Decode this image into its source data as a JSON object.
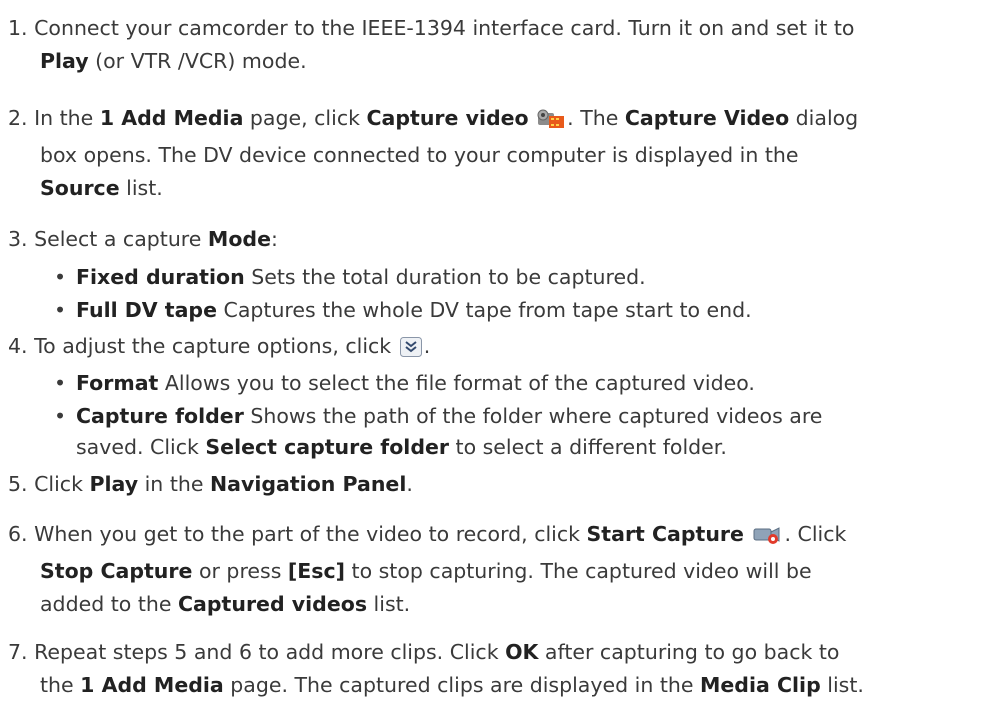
{
  "steps": [
    {
      "num": "1.",
      "p1": "Connect your camcorder to the IEEE-1394 interface card. Turn it on and set it to",
      "b1": "Play",
      "p2": " (or VTR /VCR) mode."
    },
    {
      "num": "2.",
      "p1": "In the ",
      "b1": "1 Add Media",
      "p2": " page, click ",
      "b2": "Capture video",
      "p3": ". The ",
      "b3": "Capture Video",
      "p4": " dialog",
      "p5": "box opens. The DV device connected to your computer is displayed in the",
      "b4": "Source",
      "p6": " list."
    },
    {
      "num": "3.",
      "p1": "Select a capture ",
      "b1": "Mode",
      "p2": ":"
    },
    {
      "num": "4.",
      "p1": "To adjust the capture options, click ",
      "p2": "."
    },
    {
      "num": "5.",
      "p1": "Click ",
      "b1": "Play",
      "p2": " in the ",
      "b2": "Navigation Panel",
      "p3": "."
    },
    {
      "num": "6.",
      "p1": "When you get to the part of the video to record, click ",
      "b1": "Start Capture",
      "p2": ". Click",
      "b2": "Stop Capture",
      "p3": " or press ",
      "b3": "[Esc]",
      "p4": " to stop capturing. The captured video will be",
      "p5": "added to the ",
      "b4": "Captured videos",
      "p6": " list."
    },
    {
      "num": "7.",
      "p1": "Repeat steps 5 and 6 to add more clips. Click ",
      "b1": "OK",
      "p2": " after capturing to go back to",
      "p3": "the ",
      "b2": "1 Add Media",
      "p4": " page. The captured clips are displayed in the ",
      "b3": "Media Clip",
      "p5": " list."
    }
  ],
  "bullets": [
    {
      "b": "Fixed duration",
      "t": " Sets the total duration to be captured."
    },
    {
      "b": "Full DV tape",
      "t": " Captures the whole DV tape from tape start to end."
    },
    {
      "b": "Format",
      "t": " Allows you to select the file format of the captured video."
    },
    {
      "b": "Capture folder",
      "t": " Shows the path of the folder where captured videos are",
      "t2": "saved. Click ",
      "b2": "Select capture folder",
      "t3": " to select a different folder."
    }
  ],
  "bullet_char": "•",
  "icons": [
    "capture-video-icon",
    "expand-options-icon",
    "start-capture-icon"
  ]
}
